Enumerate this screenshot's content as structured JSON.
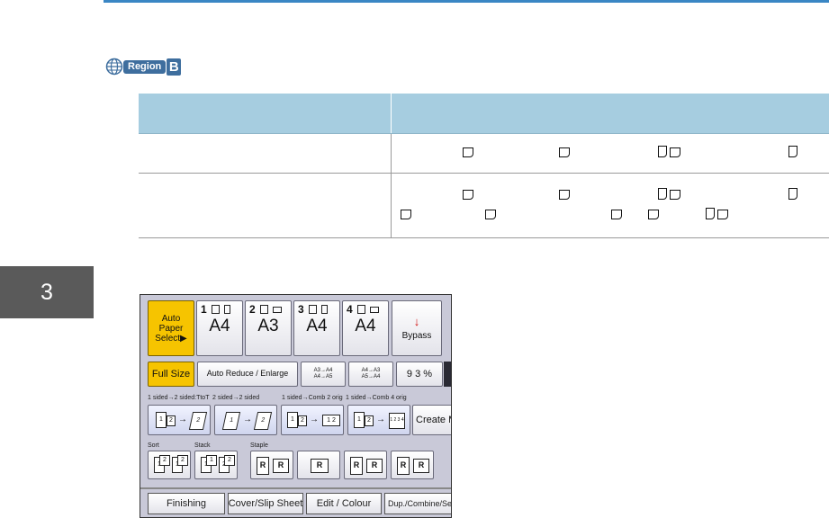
{
  "chapter": "3",
  "region": {
    "label": "Region",
    "letter": "B"
  },
  "table": {
    "headers": [
      "",
      ""
    ],
    "rows": [
      {
        "label": "",
        "value": ""
      },
      {
        "label": "",
        "value": ""
      }
    ]
  },
  "panel": {
    "auto_paper": "Auto Paper Select▶",
    "trays": [
      {
        "num": "1",
        "size": "A4"
      },
      {
        "num": "2",
        "size": "A3"
      },
      {
        "num": "3",
        "size": "A4"
      },
      {
        "num": "4",
        "size": "A4"
      }
    ],
    "bypass_label": "Bypass",
    "full_size": "Full Size",
    "auto_reduce": "Auto Reduce / Enlarge",
    "ratio_a": "A3→A4\nA4→A5",
    "ratio_b": "A4→A3\nA5→A4",
    "zoom": "9 3 %",
    "duplex_labels": [
      "1 sided→2 sided:TtoT",
      "2 sided→2 sided",
      "1 sided→Comb 2 orig",
      "1 sided→Comb 4 orig"
    ],
    "create_margin": "Create M",
    "finishing_labels": [
      "Sort",
      "Stack",
      "Staple"
    ],
    "tabs": [
      "Finishing",
      "Cover/Slip Sheet",
      "Edit / Colour",
      "Dup./Combine/Seri"
    ]
  },
  "colors": {
    "accent": "#3a86c4",
    "header_bg": "#a6cde0",
    "button_yellow": "#f6c400"
  }
}
